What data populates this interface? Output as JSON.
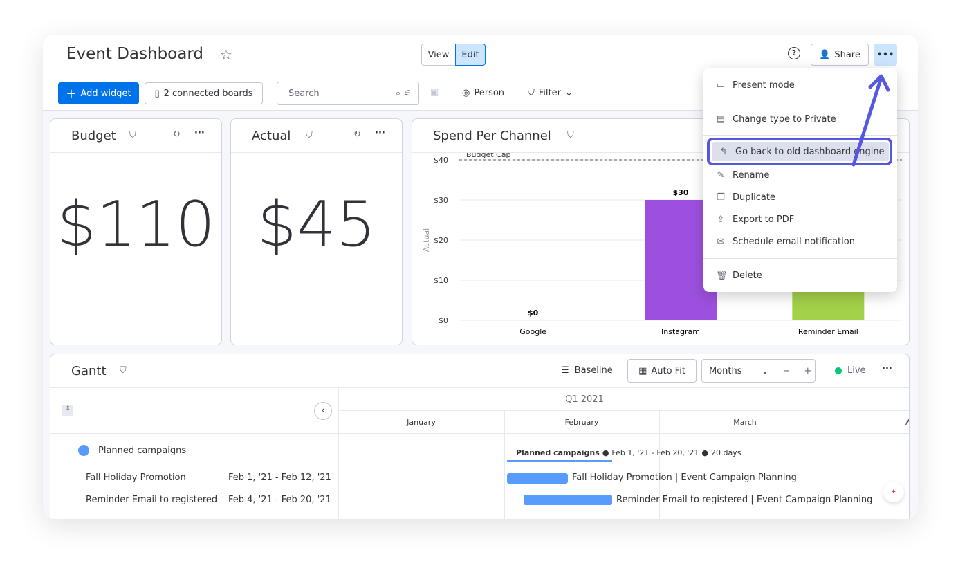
{
  "header": {
    "title": "Event Dashboard",
    "view": "View",
    "edit": "Edit",
    "share": "Share"
  },
  "toolbar": {
    "add_widget": "Add widget",
    "connected": "2 connected boards",
    "search_placeholder": "Search",
    "person": "Person",
    "filter": "Filter"
  },
  "budget": {
    "title": "Budget",
    "value": "$110"
  },
  "actual": {
    "title": "Actual",
    "value": "$45"
  },
  "chart_data": {
    "type": "bar",
    "title": "Spend Per Channel",
    "ylabel": "Actual",
    "categories": [
      "Google",
      "Instagram",
      "Reminder Email"
    ],
    "values": [
      0,
      30,
      15
    ],
    "data_labels": [
      "$0",
      "$30",
      ""
    ],
    "ylim": [
      0,
      40
    ],
    "yticks": [
      "$0",
      "$10",
      "$20",
      "$30",
      "$40"
    ],
    "colors": [
      "#9d50dd",
      "#9d50dd",
      "#a3d14a"
    ],
    "reference_line": {
      "label": "Budget Cap",
      "value": 40,
      "color": "#d83a52"
    }
  },
  "menu": {
    "items": [
      "Present mode",
      "Change type to Private",
      "Go back to old dashboard engine",
      "Rename",
      "Duplicate",
      "Export to PDF",
      "Schedule email notification",
      "Delete"
    ],
    "highlight_color": "#5559df"
  },
  "gantt": {
    "title": "Gantt",
    "baseline": "Baseline",
    "autofit": "Auto Fit",
    "scale": "Months",
    "live": "Live",
    "quarter": "Q1 2021",
    "months": [
      "January",
      "February",
      "March",
      "A"
    ],
    "group": "Planned campaigns",
    "group_summary_label": "Planned campaigns",
    "group_summary": "Feb 1, '21 - Feb 20, '21",
    "group_days": "20 days",
    "rows": [
      {
        "name": "Fall Holiday Promotion",
        "dates": "Feb 1, '21 - Feb 12, '21",
        "bar_label": "Fall Holiday Promotion | Event Campaign Planning"
      },
      {
        "name": "Reminder Email to registered",
        "dates": "Feb 4, '21 - Feb 20, '21",
        "bar_label": "Reminder Email to registered | Event Campaign Planning"
      }
    ]
  }
}
